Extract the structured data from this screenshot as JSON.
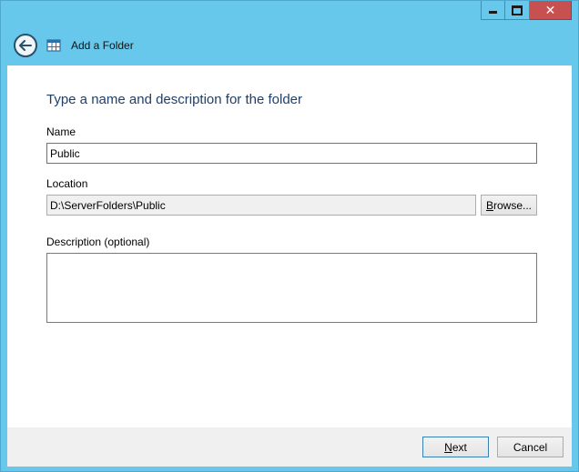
{
  "window": {
    "title": "Add a Folder",
    "caption_buttons": {
      "minimize_icon": "minimize-icon",
      "maximize_icon": "maximize-icon",
      "close_icon": "close-icon"
    }
  },
  "page": {
    "heading": "Type a name and description for the folder"
  },
  "form": {
    "name_label": "Name",
    "name_value": "Public",
    "location_label": "Location",
    "location_value": "D:\\ServerFolders\\Public",
    "browse_label_access": "B",
    "browse_label_rest": "rowse...",
    "description_label": "Description (optional)",
    "description_value": ""
  },
  "footer": {
    "next_access": "N",
    "next_rest": "ext",
    "cancel_label": "Cancel"
  },
  "colors": {
    "chrome": "#67c8eb",
    "heading": "#1e3f6a",
    "close_button": "#c75050"
  }
}
